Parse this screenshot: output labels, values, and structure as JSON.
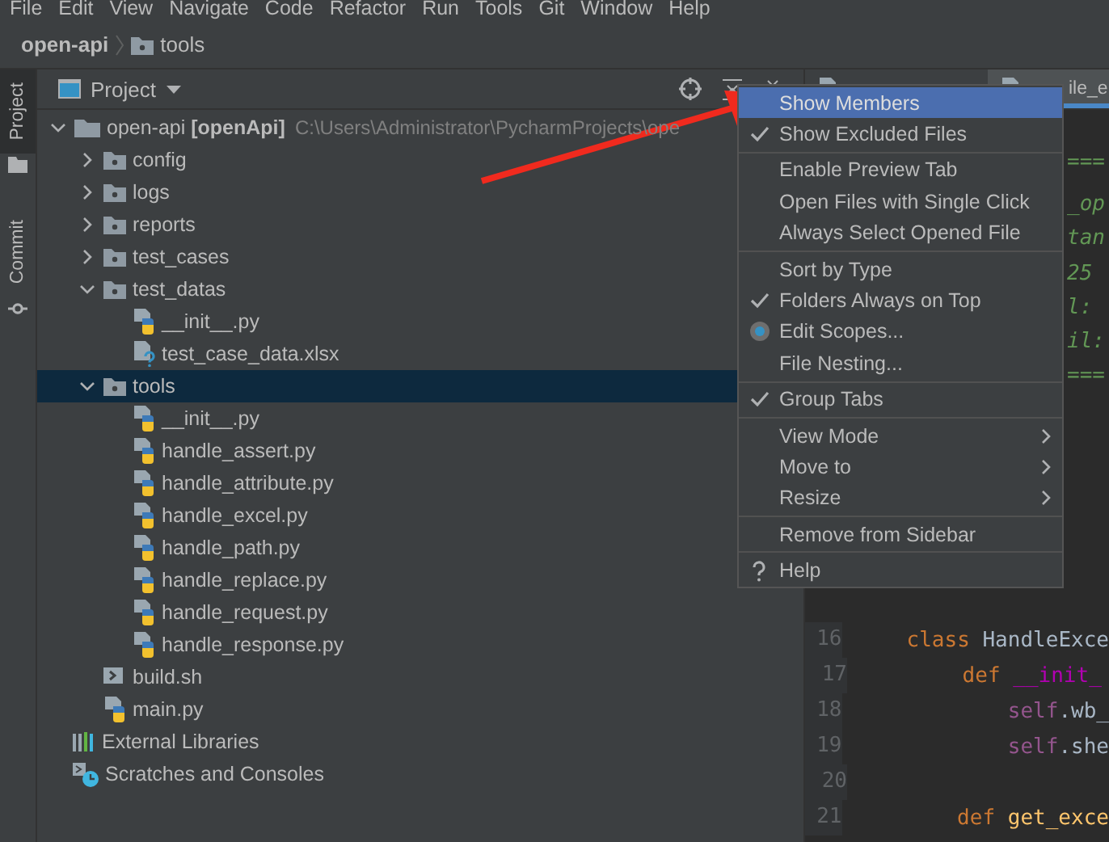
{
  "menubar": [
    "File",
    "Edit",
    "View",
    "Navigate",
    "Code",
    "Refactor",
    "Run",
    "Tools",
    "Git",
    "Window",
    "Help"
  ],
  "breadcrumb": {
    "project": "open-api",
    "folder": "tools"
  },
  "side_tabs": [
    {
      "label": "Project",
      "selected": true
    },
    {
      "label": "Commit",
      "selected": false
    }
  ],
  "project_panel": {
    "title": "Project",
    "tree": [
      {
        "label": "open-api **[openApi]**",
        "path": "C:\\Users\\Administrator\\PycharmProjects\\ope",
        "kind": "module",
        "expanded": true,
        "selected": false,
        "children": [
          {
            "label": "config",
            "kind": "folder",
            "expanded": false,
            "selected": false
          },
          {
            "label": "logs",
            "kind": "folder",
            "expanded": false,
            "selected": false
          },
          {
            "label": "reports",
            "kind": "folder",
            "expanded": false,
            "selected": false
          },
          {
            "label": "test_cases",
            "kind": "folder",
            "expanded": false,
            "selected": false
          },
          {
            "label": "test_datas",
            "kind": "folder",
            "expanded": true,
            "selected": false,
            "children": [
              {
                "label": "__init__.py",
                "kind": "python",
                "selected": false
              },
              {
                "label": "test_case_data.xlsx",
                "kind": "unknown",
                "selected": false
              }
            ]
          },
          {
            "label": "tools",
            "kind": "folder",
            "expanded": true,
            "selected": true,
            "children": [
              {
                "label": "__init__.py",
                "kind": "python",
                "selected": false
              },
              {
                "label": "handle_assert.py",
                "kind": "python",
                "selected": false
              },
              {
                "label": "handle_attribute.py",
                "kind": "python",
                "selected": false
              },
              {
                "label": "handle_excel.py",
                "kind": "python",
                "selected": false
              },
              {
                "label": "handle_path.py",
                "kind": "python",
                "selected": false
              },
              {
                "label": "handle_replace.py",
                "kind": "python",
                "selected": false
              },
              {
                "label": "handle_request.py",
                "kind": "python",
                "selected": false
              },
              {
                "label": "handle_response.py",
                "kind": "python",
                "selected": false
              }
            ]
          },
          {
            "label": "build.sh",
            "kind": "shell",
            "selected": false
          },
          {
            "label": "main.py",
            "kind": "python",
            "selected": false
          }
        ]
      },
      {
        "label": "External Libraries",
        "kind": "libraries",
        "selected": false
      },
      {
        "label": "Scratches and Consoles",
        "kind": "scratches",
        "selected": false
      }
    ]
  },
  "editor": {
    "tabs": [
      {
        "selected": false
      },
      {
        "label": "ile_e",
        "selected": true
      }
    ],
    "fragments": [
      "===",
      "_op",
      "tan",
      "25",
      "l:",
      "il:",
      "==="
    ],
    "lines": [
      {
        "number": "16",
        "tokens": [
          {
            "text": "class",
            "kind": "keyword"
          },
          {
            "text": " HandleExce",
            "kind": "plain"
          }
        ]
      },
      {
        "number": "17",
        "tokens": [
          {
            "text": "    def",
            "kind": "keyword"
          },
          {
            "text": " __init_",
            "kind": "magic"
          }
        ]
      },
      {
        "number": "18",
        "tokens": [
          {
            "text": "        self",
            "kind": "self"
          },
          {
            "text": ".wb_",
            "kind": "plain"
          }
        ]
      },
      {
        "number": "19",
        "tokens": [
          {
            "text": "        self",
            "kind": "self"
          },
          {
            "text": ".she",
            "kind": "plain"
          }
        ]
      },
      {
        "number": "20"
      },
      {
        "number": "21",
        "tokens": [
          {
            "text": "    def",
            "kind": "keyword"
          },
          {
            "text": " get_exce",
            "kind": "function"
          }
        ]
      }
    ]
  },
  "context_menu": {
    "groups": [
      [
        {
          "label": "Show Members",
          "kind": "check",
          "checked": false,
          "selected": true
        },
        {
          "label": "Show Excluded Files",
          "kind": "check",
          "checked": true,
          "selected": false
        }
      ],
      [
        {
          "label": "Enable Preview Tab",
          "kind": "check",
          "checked": false,
          "selected": false
        },
        {
          "label": "Open Files with Single Click",
          "kind": "check",
          "checked": false,
          "selected": false
        },
        {
          "label": "Always Select Opened File",
          "kind": "check",
          "checked": false,
          "selected": false
        }
      ],
      [
        {
          "label": "Sort by Type",
          "kind": "check",
          "checked": false,
          "selected": false
        },
        {
          "label": "Folders Always on Top",
          "kind": "check",
          "checked": true,
          "selected": false
        },
        {
          "label": "Edit Scopes...",
          "kind": "radio",
          "checked": true,
          "selected": false
        },
        {
          "label": "File Nesting...",
          "kind": "check",
          "checked": false,
          "selected": false
        }
      ],
      [
        {
          "label": "Group Tabs",
          "kind": "check",
          "checked": true,
          "selected": false
        }
      ],
      [
        {
          "label": "View Mode",
          "kind": "submenu",
          "selected": false
        },
        {
          "label": "Move to",
          "kind": "submenu",
          "selected": false
        },
        {
          "label": "Resize",
          "kind": "submenu",
          "selected": false
        }
      ],
      [
        {
          "label": "Remove from Sidebar",
          "kind": "check",
          "checked": false,
          "selected": false
        }
      ],
      [
        {
          "label": "Help",
          "kind": "help",
          "selected": false
        }
      ]
    ]
  },
  "annotation": {
    "kind": "arrow",
    "color": "#f02a1e"
  }
}
